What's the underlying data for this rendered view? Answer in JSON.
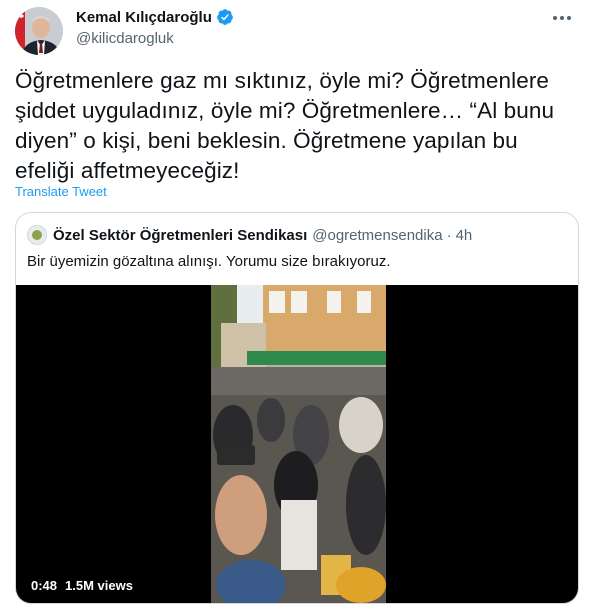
{
  "author": {
    "name": "Kemal Kılıçdaroğlu",
    "handle": "@kilicdarogluk",
    "avatar_icon": "profile-photo",
    "verified_icon": "verified-badge-icon"
  },
  "tweet": {
    "text": "Öğretmenlere gaz mı sıktınız, öyle mi? Öğretmenlere şiddet uyguladınız, öyle mi? Öğretmenlere… “Al bunu diyen” o kişi, beni beklesin. Öğretmene yapılan bu efeliği affetmeyeceğiz!",
    "translate_label": "Translate Tweet"
  },
  "quoted": {
    "name": "Özel Sektör Öğretmenleri Sendikası",
    "handle": "@ogretmensendika",
    "separator": "·",
    "time": "4h",
    "text": "Bir üyemizin gözaltına alınışı. Yorumu size bırakıyoruz.",
    "video": {
      "duration": "0:48",
      "views": "1.5M views"
    }
  },
  "colors": {
    "accent": "#1d9bf0",
    "secondary_text": "#536471",
    "border": "#cfd9de"
  }
}
